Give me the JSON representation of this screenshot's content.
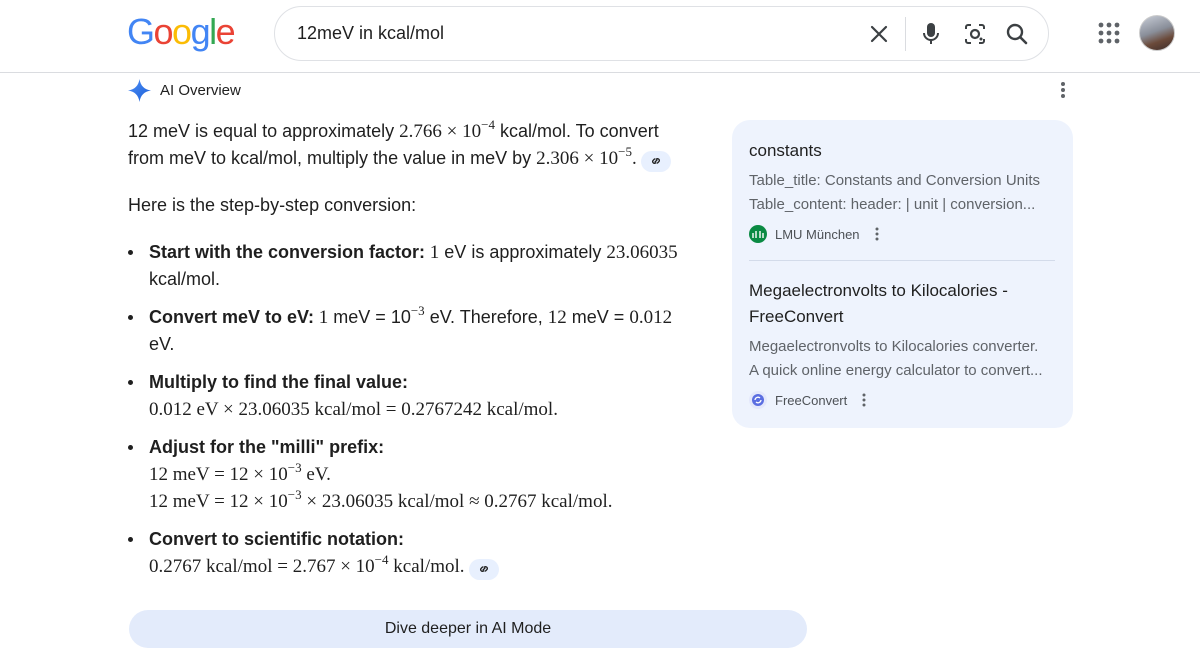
{
  "search": {
    "query": "12meV in kcal/mol"
  },
  "ai_overview": {
    "title": "AI Overview",
    "dive_label": "Dive deeper in AI Mode"
  },
  "answer": {
    "p1_a": "12 meV is equal to approximately ",
    "p1_num1": "2.766",
    "p1_times1": " × 10",
    "p1_exp1": "−4",
    "p1_b": " kcal/mol. To convert from meV to kcal/mol, multiply the value in meV by ",
    "p1_num2": "2.306 × 10",
    "p1_exp2": "−5",
    "p1_end": ".",
    "p2": "Here is the step-by-step conversion:",
    "step1_label": "Start with the conversion factor:",
    "step1_one": " 1",
    "step1_text": " eV is approximately ",
    "step1_val": "23.06035",
    "step1_unit": " kcal/mol.",
    "step2_label": "Convert meV to eV:",
    "step2_a": " 1",
    "step2_b": " meV = 10",
    "step2_exp": "−3",
    "step2_c": " eV. Therefore, ",
    "step2_d": "12",
    "step2_e": " meV = ",
    "step2_f": "0.012",
    "step2_g": " eV.",
    "step3_label": "Multiply to find the final value:",
    "step3_line": "0.012 eV × 23.06035 kcal/mol = 0.2767242 kcal/mol.",
    "step4_label": "Adjust for the \"milli\" prefix:",
    "step4_l1_a": "12 meV = 12 × 10",
    "step4_l1_exp": "−3",
    "step4_l1_b": " eV.",
    "step4_l2_a": "12 meV = 12 × 10",
    "step4_l2_exp": "−3",
    "step4_l2_b": " × 23.06035 kcal/mol ≈ 0.2767 kcal/mol.",
    "step5_label": "Convert to scientific notation:",
    "step5_a": "0.2767 kcal/mol = 2.767 × 10",
    "step5_exp": "−4",
    "step5_b": " kcal/mol."
  },
  "sources": [
    {
      "title": "constants",
      "snippet1": "Table_title: Constants and Conversion Units",
      "snippet2": "Table_content: header: | unit | conversion...",
      "site": "LMU München",
      "favicon_color": "#0a8a43"
    },
    {
      "title": "Megaelectronvolts to Kilocalories - FreeConvert",
      "snippet1": "Megaelectronvolts to Kilocalories converter.",
      "snippet2": "A quick online energy calculator to convert...",
      "site": "FreeConvert",
      "favicon_color": "#5b6ee1"
    }
  ],
  "colors": {
    "accent": "#1a73e8",
    "chip": "#e8f0fe",
    "panel": "#eef3fd"
  }
}
